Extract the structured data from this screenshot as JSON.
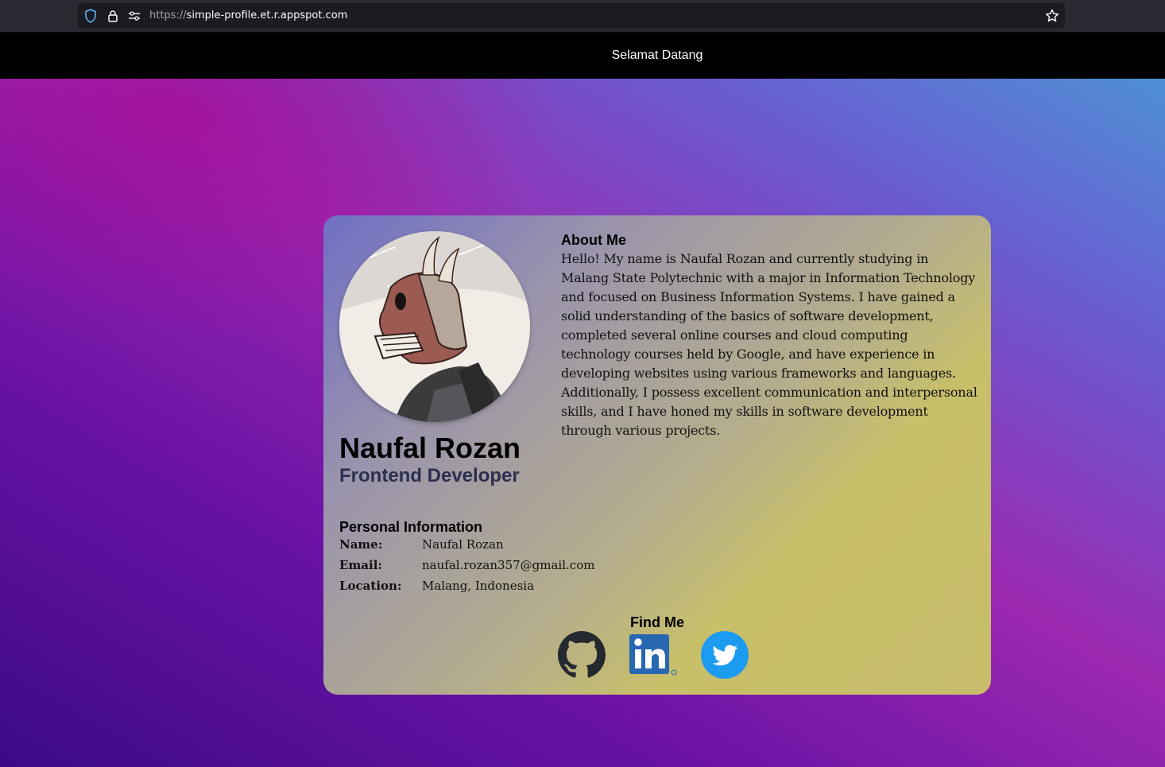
{
  "browser": {
    "url_scheme": "https://",
    "url_host": "simple-profile.et.r.appspot.com",
    "icons": [
      "shield-icon",
      "lock-icon",
      "site-settings-icon",
      "bookmark-star-icon"
    ]
  },
  "header": {
    "title": "Selamat Datang"
  },
  "profile": {
    "name": "Naufal Rozan",
    "role": "Frontend Developer",
    "avatar": "masked-character-illustration"
  },
  "about": {
    "title": "About Me",
    "text": "Hello! My name is Naufal Rozan and currently studying in Malang State Polytechnic with a major in Information Technology and focused on Business Information Systems. I have gained a solid understanding of the basics of software development, completed several online courses and cloud computing technology courses held by Google, and have experience in developing websites using various frameworks and languages. Additionally, I possess excellent communication and interpersonal skills, and I have honed my skills in software development through various projects."
  },
  "personal": {
    "title": "Personal Information",
    "rows": [
      {
        "label": "Name:",
        "value": "Naufal Rozan"
      },
      {
        "label": "Email:",
        "value": "naufal.rozan357@gmail.com"
      },
      {
        "label": "Location:",
        "value": "Malang, Indonesia"
      }
    ]
  },
  "find": {
    "title": "Find Me",
    "links": [
      "github-icon",
      "linkedin-icon",
      "twitter-icon"
    ]
  },
  "colors": {
    "header_bg": "#000000",
    "twitter": "#1d9bf0",
    "linkedin": "#2867b2",
    "github": "#24292f"
  }
}
